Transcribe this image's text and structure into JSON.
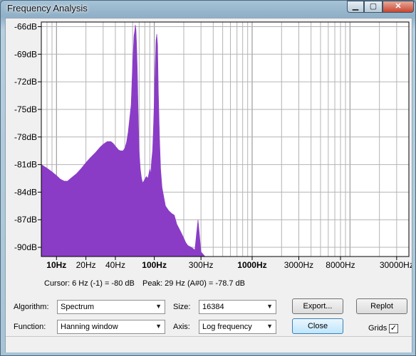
{
  "window": {
    "title": "Frequency Analysis",
    "minimize_glyph": "▁",
    "maximize_glyph": "▢",
    "close_glyph": "✕"
  },
  "chart_data": {
    "type": "area",
    "xscale": "log",
    "xlim": [
      7,
      40000
    ],
    "ylim": [
      -91,
      -65.5
    ],
    "grid": true,
    "ylabel_ticks": [
      "-66dB",
      "-69dB",
      "-72dB",
      "-75dB",
      "-78dB",
      "-81dB",
      "-84dB",
      "-87dB",
      "-90dB"
    ],
    "y_tick_values": [
      -66,
      -69,
      -72,
      -75,
      -78,
      -81,
      -84,
      -87,
      -90
    ],
    "x_tick_labels": [
      {
        "label": "10Hz",
        "value": 10,
        "bold": true
      },
      {
        "label": "20Hz",
        "value": 20,
        "bold": false
      },
      {
        "label": "40Hz",
        "value": 40,
        "bold": false
      },
      {
        "label": "100Hz",
        "value": 100,
        "bold": true
      },
      {
        "label": "300Hz",
        "value": 300,
        "bold": false
      },
      {
        "label": "1000Hz",
        "value": 1000,
        "bold": true
      },
      {
        "label": "3000Hz",
        "value": 3000,
        "bold": false
      },
      {
        "label": "8000Hz",
        "value": 8000,
        "bold": false
      },
      {
        "label": "30000Hz",
        "value": 30000,
        "bold": false
      }
    ],
    "fill_color": "#8a3cc6",
    "series": [
      {
        "x": [
          7,
          8,
          9,
          10,
          11,
          12,
          13,
          14,
          16,
          18,
          20,
          22,
          25,
          28,
          30,
          33,
          36,
          38,
          40,
          43,
          45,
          48,
          50,
          52,
          54,
          56,
          58,
          60,
          62,
          63,
          64,
          65,
          66,
          67,
          68,
          69,
          70,
          72,
          74,
          76,
          78,
          80,
          83,
          86,
          88,
          90,
          92,
          94,
          96,
          98,
          100,
          102,
          104,
          106,
          108,
          110,
          113,
          116,
          120,
          125,
          130,
          140,
          150,
          160,
          170,
          180,
          190,
          200,
          210,
          220,
          240,
          260,
          270,
          280,
          300,
          330,
          360,
          400
        ],
        "y": [
          -81.0,
          -81.4,
          -81.8,
          -82.2,
          -82.6,
          -82.8,
          -82.8,
          -82.5,
          -82.0,
          -81.4,
          -80.8,
          -80.3,
          -79.7,
          -79.1,
          -78.8,
          -78.5,
          -78.5,
          -78.7,
          -79.0,
          -79.4,
          -79.5,
          -79.5,
          -79.2,
          -78.6,
          -77.5,
          -76.0,
          -74.5,
          -70.0,
          -67.0,
          -66.5,
          -65.8,
          -66.3,
          -68.0,
          -70.5,
          -74.0,
          -77.0,
          -79.5,
          -81.5,
          -82.5,
          -83.0,
          -82.8,
          -82.6,
          -82.3,
          -82.5,
          -82.0,
          -81.5,
          -82.0,
          -80.5,
          -79.5,
          -77.0,
          -74.0,
          -70.5,
          -67.5,
          -66.8,
          -68.0,
          -73.0,
          -78.0,
          -81.5,
          -83.5,
          -84.5,
          -85.5,
          -86.0,
          -86.3,
          -86.5,
          -87.5,
          -88.0,
          -88.5,
          -89.0,
          -89.5,
          -89.8,
          -90.0,
          -90.3,
          -88.5,
          -87.0,
          -90.5,
          -91,
          -91,
          -91
        ]
      }
    ]
  },
  "readout": {
    "cursor_text": "Cursor: 6 Hz (-1) = -80 dB",
    "peak_text": "Peak: 29 Hz (A#0) = -78.7 dB"
  },
  "controls": {
    "algorithm_label": "Algorithm:",
    "algorithm_value": "Spectrum",
    "size_label": "Size:",
    "size_value": "16384",
    "function_label": "Function:",
    "function_value": "Hanning window",
    "axis_label": "Axis:",
    "axis_value": "Log frequency",
    "export_label": "Export...",
    "replot_label": "Replot",
    "close_label": "Close",
    "grids_label": "Grids",
    "grids_checked": true,
    "dropdown_glyph": "▼",
    "check_glyph": "✓"
  }
}
